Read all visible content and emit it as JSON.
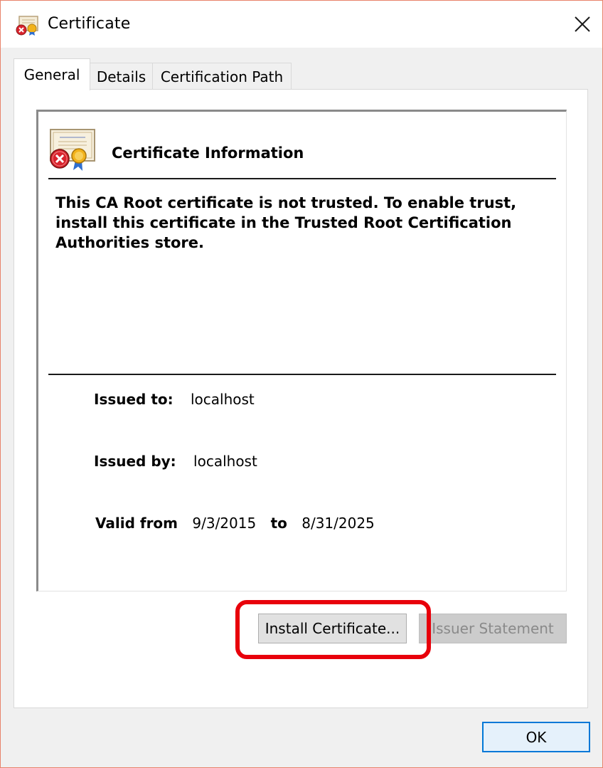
{
  "window": {
    "title": "Certificate",
    "close_symbol": "✕"
  },
  "tabs": [
    {
      "label": "General",
      "active": true
    },
    {
      "label": "Details",
      "active": false
    },
    {
      "label": "Certification Path",
      "active": false
    }
  ],
  "info": {
    "heading": "Certificate Information",
    "message": "This CA Root certificate is not trusted. To enable trust, install this certificate in the Trusted Root Certification Authorities store.",
    "issued_to_label": "Issued to:",
    "issued_to_value": "localhost",
    "issued_by_label": "Issued by:",
    "issued_by_value": "localhost",
    "valid_from_label": "Valid from",
    "valid_from_value": "9/3/2015",
    "valid_to_label": "to",
    "valid_to_value": "8/31/2025"
  },
  "buttons": {
    "install": "Install Certificate...",
    "issuer": "Issuer Statement",
    "ok": "OK"
  },
  "icons": {
    "title": "certificate-untrusted-icon",
    "info": "certificate-untrusted-icon",
    "close": "close-icon"
  },
  "colors": {
    "highlight": "#e8000b",
    "ok_border": "#0078d7",
    "window_border": "#e8836b"
  }
}
